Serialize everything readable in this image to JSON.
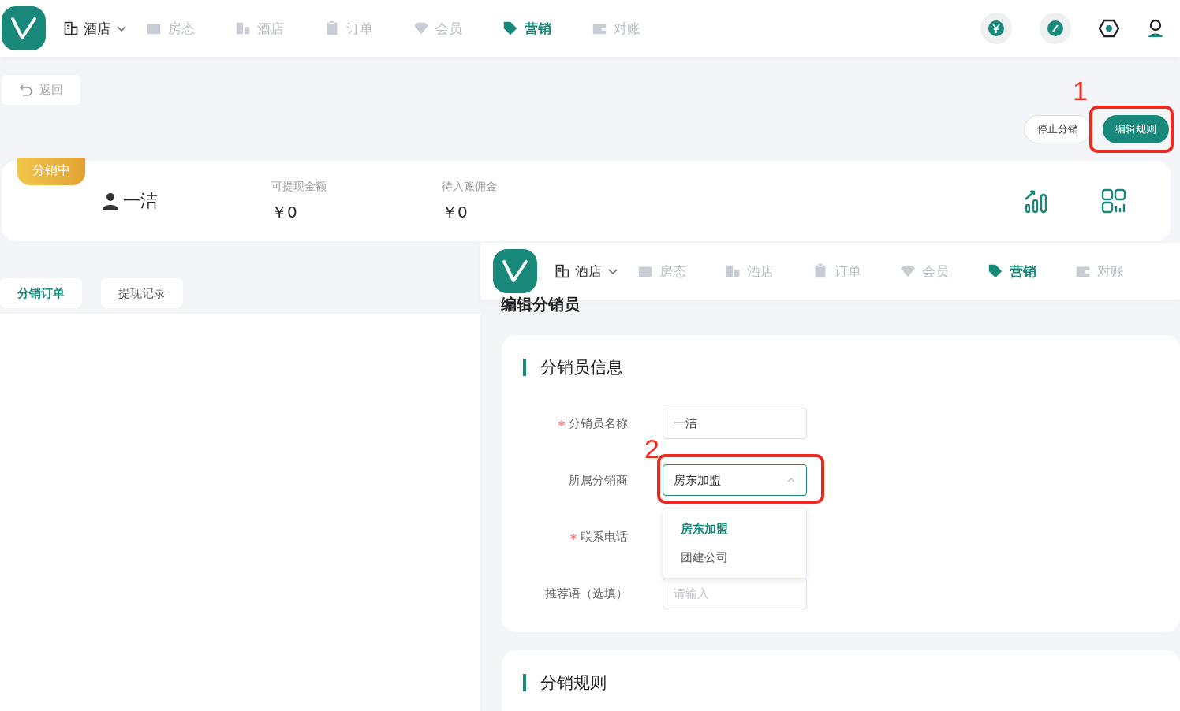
{
  "nav": {
    "hotel_select": "酒店",
    "items": [
      {
        "label": "房态",
        "selected": false
      },
      {
        "label": "酒店",
        "selected": false
      },
      {
        "label": "订单",
        "selected": false
      },
      {
        "label": "会员",
        "selected": false
      },
      {
        "label": "营销",
        "selected": true
      },
      {
        "label": "对账",
        "selected": false
      }
    ]
  },
  "back_button": "返回",
  "actions": [
    {
      "label": "停止分销",
      "kind": "outline"
    },
    {
      "label": "编辑规则",
      "kind": "primary"
    }
  ],
  "annotations": [
    "1",
    "2"
  ],
  "summary": {
    "badge": "分销中",
    "name": "一洁",
    "stats": [
      {
        "label": "可提现金额",
        "value": "￥0"
      },
      {
        "label": "待入账佣金",
        "value": "￥0"
      }
    ]
  },
  "tabs": [
    {
      "label": "分销订单",
      "selected": true
    },
    {
      "label": "提现记录",
      "selected": false
    }
  ],
  "overlay": {
    "nav": {
      "hotel_select": "酒店",
      "items": [
        {
          "label": "房态",
          "selected": false
        },
        {
          "label": "酒店",
          "selected": false
        },
        {
          "label": "订单",
          "selected": false
        },
        {
          "label": "会员",
          "selected": false
        },
        {
          "label": "营销",
          "selected": true
        },
        {
          "label": "对账",
          "selected": false
        }
      ]
    },
    "page_title": "编辑分销员",
    "sections": [
      "分销员信息",
      "分销规则"
    ],
    "form": [
      {
        "label": "分销员名称",
        "required": true,
        "kind": "input",
        "value": "一洁"
      },
      {
        "label": "所属分销商",
        "required": false,
        "kind": "select",
        "value": "房东加盟"
      },
      {
        "label": "联系电话",
        "required": true,
        "kind": "hidden"
      },
      {
        "label": "推荐语（选填）",
        "required": false,
        "kind": "input",
        "placeholder": "请输入"
      }
    ],
    "dropdown": [
      {
        "label": "房东加盟",
        "selected": true
      },
      {
        "label": "团建公司",
        "selected": false
      }
    ]
  }
}
